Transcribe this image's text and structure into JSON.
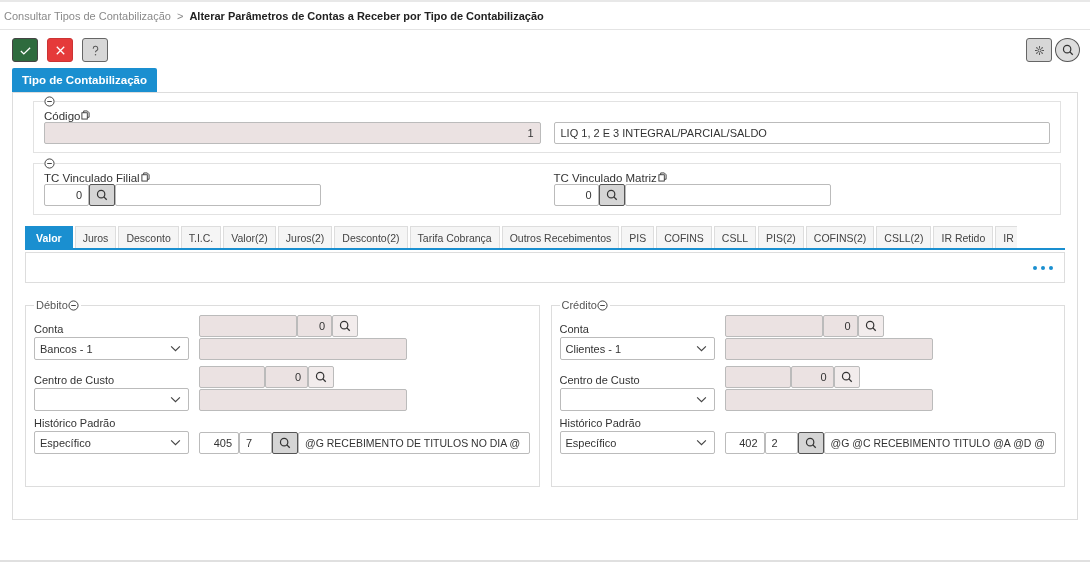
{
  "breadcrumb": [
    {
      "label": "Consultar Tipos de Contabilização",
      "current": false
    },
    {
      "label": "Alterar Parâmetros de Contas a Receber por Tipo de Contabilização",
      "current": true
    }
  ],
  "breadcrumb_separator": ">",
  "toolbar": [
    {
      "kind": "confirm"
    },
    {
      "kind": "cancel"
    },
    {
      "kind": "help"
    }
  ],
  "toolbar_right": [
    {
      "kind": "settings"
    },
    {
      "kind": "search"
    }
  ],
  "header_tab": "Tipo de Contabilização",
  "codigo": {
    "label": "Código",
    "value": "1",
    "description": "LIQ 1, 2 E 3 INTEGRAL/PARCIAL/SALDO"
  },
  "vinculados": [
    {
      "label": "TC Vinculado Filial",
      "value": "0"
    },
    {
      "label": "TC Vinculado Matriz",
      "value": "0"
    }
  ],
  "tabs": [
    {
      "label": "Valor",
      "selected": true
    },
    {
      "label": "Juros",
      "selected": false
    },
    {
      "label": "Desconto",
      "selected": false
    },
    {
      "label": "T.I.C.",
      "selected": false
    },
    {
      "label": "Valor(2)",
      "selected": false
    },
    {
      "label": "Juros(2)",
      "selected": false
    },
    {
      "label": "Desconto(2)",
      "selected": false
    },
    {
      "label": "Tarifa Cobrança",
      "selected": false
    },
    {
      "label": "Outros Recebimentos",
      "selected": false
    },
    {
      "label": "PIS",
      "selected": false
    },
    {
      "label": "COFINS",
      "selected": false
    },
    {
      "label": "CSLL",
      "selected": false
    },
    {
      "label": "PIS(2)",
      "selected": false
    },
    {
      "label": "COFINS(2)",
      "selected": false
    },
    {
      "label": "CSLL(2)",
      "selected": false
    },
    {
      "label": "IR Retido",
      "selected": false
    },
    {
      "label": "IR",
      "selected": false
    }
  ],
  "panels": [
    {
      "title": "Débito",
      "conta": {
        "label": "Conta",
        "select": "Bancos - 1",
        "code": "0"
      },
      "centro": {
        "label": "Centro de Custo",
        "code": "0"
      },
      "historico": {
        "label": "Histórico Padrão",
        "select": "Específico",
        "code": "405",
        "seq": "7",
        "text": "@G RECEBIMENTO DE TITULOS NO DIA @"
      }
    },
    {
      "title": "Crédito",
      "conta": {
        "label": "Conta",
        "select": "Clientes - 1",
        "code": "0"
      },
      "centro": {
        "label": "Centro de Custo",
        "code": "0"
      },
      "historico": {
        "label": "Histórico Padrão",
        "select": "Específico",
        "code": "402",
        "seq": "2",
        "text": "@G @C RECEBIMENTO TITULO @A @D @"
      }
    }
  ]
}
